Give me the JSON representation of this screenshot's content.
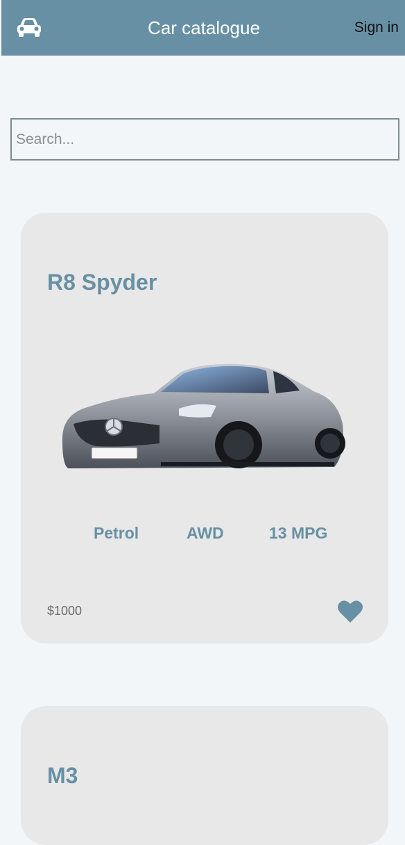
{
  "header": {
    "logo_icon": "car-icon",
    "title": "Car catalogue",
    "signin_label": "Sign in"
  },
  "search": {
    "placeholder": "Search..."
  },
  "cars": [
    {
      "name": "R8 Spyder",
      "fuel": "Petrol",
      "drive": "AWD",
      "mpg": "13 MPG",
      "price": "$1000",
      "favorite_icon": "heart-icon"
    },
    {
      "name": "M3"
    }
  ],
  "colors": {
    "header": "#6790a4",
    "accent": "#6790a4",
    "background": "#f3f6f9",
    "card": "#e8e8e8"
  }
}
